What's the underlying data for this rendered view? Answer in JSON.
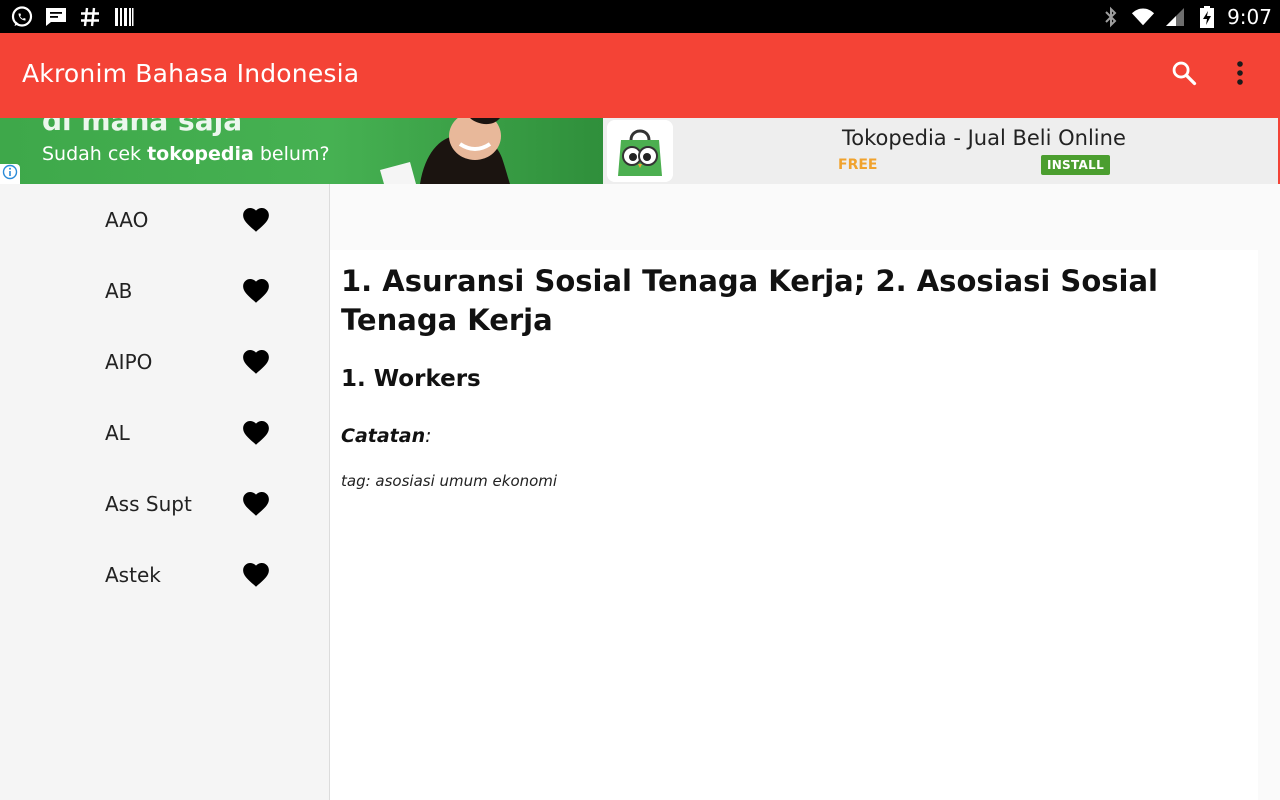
{
  "status_bar": {
    "time": "9:07",
    "left_icons": [
      "whatsapp-icon",
      "message-icon",
      "hash-icon",
      "barcode-icon"
    ],
    "right_icons": [
      "bluetooth-icon",
      "wifi-icon",
      "signal-icon",
      "battery-charging-icon"
    ]
  },
  "app_bar": {
    "title": "Akronim Bahasa Indonesia",
    "actions": [
      "search-icon",
      "more-vert-icon"
    ],
    "color": "#f44336"
  },
  "ad": {
    "headline": "di mana saja",
    "tagline_prefix": "Sudah cek ",
    "tagline_brand": "tokopedia",
    "tagline_suffix": " belum?",
    "app_title": "Tokopedia - Jual Beli Online",
    "price": "FREE",
    "install_label": "INSTALL"
  },
  "list": {
    "items": [
      {
        "label": "AAO"
      },
      {
        "label": "AB"
      },
      {
        "label": "AIPO"
      },
      {
        "label": "AL"
      },
      {
        "label": "Ass Supt"
      },
      {
        "label": "Astek"
      }
    ]
  },
  "detail": {
    "definition": "1. Asuransi Sosial Tenaga Kerja; 2. Asosiasi Sosial Tenaga Kerja",
    "english": "1. Workers",
    "note_label": "Catatan",
    "note_colon": ":",
    "tags": "tag: asosiasi umum ekonomi"
  }
}
